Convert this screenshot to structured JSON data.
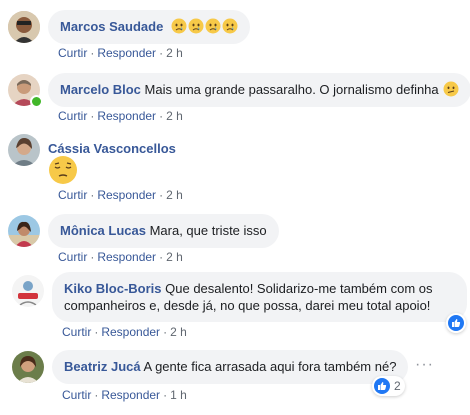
{
  "actions": {
    "like": "Curtir",
    "reply": "Responder",
    "separator": "·"
  },
  "comments": [
    {
      "author": "Marcos Saudade",
      "text": "",
      "emoji": [
        "sad-face-icon",
        "sad-face-icon",
        "sad-face-icon",
        "sad-face-icon"
      ],
      "time": "2 h"
    },
    {
      "author": "Marcelo Bloc",
      "text": "Mais uma grande passaralho. O jornalismo definha",
      "emoji": [
        "confused-face-icon"
      ],
      "time": "2 h",
      "online": true
    },
    {
      "author": "Cássia Vasconcellos",
      "text": "",
      "emoji": [
        "pensive-face-icon"
      ],
      "time": "2 h"
    },
    {
      "author": "Mônica Lucas",
      "text": "Mara, que triste isso",
      "time": "2 h"
    },
    {
      "author": "Kiko Bloc-Boris",
      "text_line1": "Que desalento! Solidarizo-me também com os",
      "text_line2": "companheiros e, desde já, no que possa, darei meu total apoio!",
      "time": "2 h",
      "reaction": {
        "icon": "like-icon",
        "count": ""
      }
    },
    {
      "author": "Beatriz Jucá",
      "text": "A gente fica arrasada aqui fora também né?",
      "time": "1 h",
      "reaction": {
        "icon": "like-icon",
        "count": "2"
      }
    }
  ],
  "more_options_icon": "more-options-icon",
  "colors": {
    "author": "#385898",
    "bubble": "#f2f3f5",
    "meta": "#606770",
    "like": "#2078f4",
    "online": "#42b72a"
  }
}
